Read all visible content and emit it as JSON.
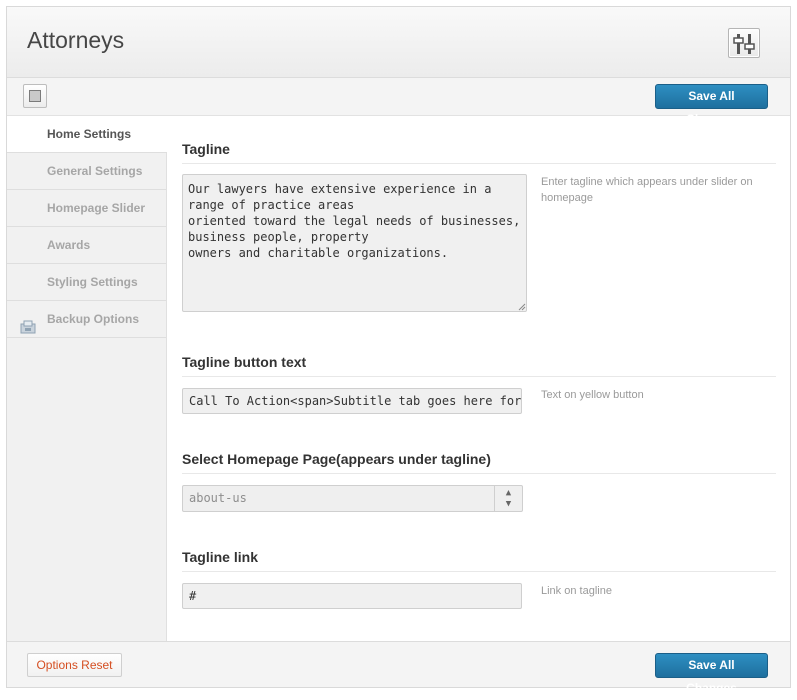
{
  "header": {
    "title": "Attorneys",
    "icon": "settings-sliders-icon"
  },
  "toolbar": {
    "save_label": "Save All Changes",
    "toggle_icon": "panel-toggle-icon"
  },
  "sidebar": {
    "items": [
      {
        "label": "Home Settings",
        "active": true
      },
      {
        "label": "General Settings",
        "active": false
      },
      {
        "label": "Homepage Slider",
        "active": false
      },
      {
        "label": "Awards",
        "active": false
      },
      {
        "label": "Styling Settings",
        "active": false
      },
      {
        "label": "Backup Options",
        "active": false,
        "icon": "backup-icon"
      }
    ]
  },
  "main": {
    "tagline": {
      "title": "Tagline",
      "value": "Our lawyers have extensive experience in a range of practice areas\noriented toward the legal needs of businesses, business people, property\nowners and charitable organizations.",
      "description": "Enter tagline which appears under slider on homepage"
    },
    "tagline_button": {
      "title": "Tagline button text",
      "value": "Call To Action<span>Subtitle tab goes here for slogan</span>",
      "description": "Text on yellow button"
    },
    "homepage_page": {
      "title": "Select Homepage Page(appears under tagline)",
      "selected": "about-us"
    },
    "tagline_link": {
      "title": "Tagline link",
      "value": "#",
      "description": "Link on tagline"
    }
  },
  "footer": {
    "reset_label": "Options Reset",
    "save_label": "Save All Changes"
  },
  "colors": {
    "accent": "#2582b4",
    "reset_text": "#d54e21"
  }
}
